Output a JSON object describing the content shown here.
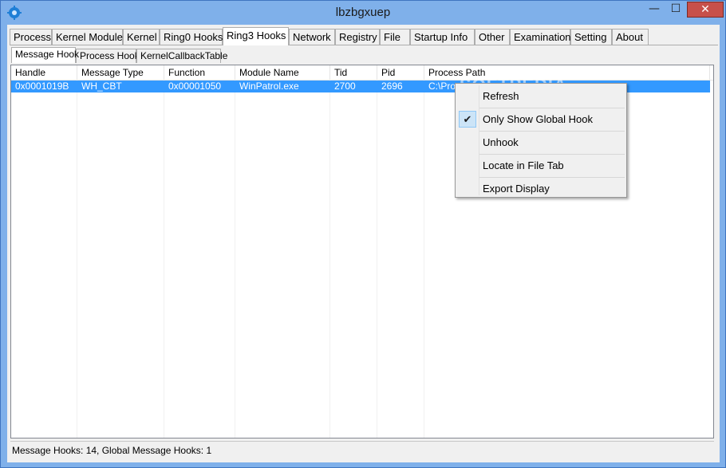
{
  "window": {
    "title": "lbzbgxuep"
  },
  "titlebar_buttons": {
    "minimize": "—",
    "maximize": "☐",
    "close": "✕"
  },
  "main_tabs": [
    {
      "label": "Process"
    },
    {
      "label": "Kernel Module"
    },
    {
      "label": "Kernel"
    },
    {
      "label": "Ring0 Hooks"
    },
    {
      "label": "Ring3 Hooks",
      "active": true
    },
    {
      "label": "Network"
    },
    {
      "label": "Registry"
    },
    {
      "label": "File"
    },
    {
      "label": "Startup Info"
    },
    {
      "label": "Other"
    },
    {
      "label": "Examination"
    },
    {
      "label": "Setting"
    },
    {
      "label": "About"
    }
  ],
  "sub_tabs": [
    {
      "label": "Message Hook",
      "active": true
    },
    {
      "label": "Process Hook"
    },
    {
      "label": "KernelCallbackTable"
    }
  ],
  "table": {
    "columns": [
      "Handle",
      "Message Type",
      "Function",
      "Module Name",
      "Tid",
      "Pid",
      "Process Path"
    ],
    "rows": [
      [
        "0x0001019B",
        "WH_CBT",
        "0x00001050",
        "WinPatrol.exe",
        "2700",
        "2696",
        "C:\\Proc"
      ]
    ]
  },
  "context_menu": {
    "items": [
      {
        "label": "Refresh"
      },
      {
        "label": "Only Show Global Hook",
        "checked": true
      },
      {
        "label": "Unhook"
      },
      {
        "label": "Locate in File Tab"
      },
      {
        "label": "Export Display"
      }
    ]
  },
  "status": {
    "text": "Message Hooks: 14, Global Message Hooks: 1"
  },
  "watermark": "SOFTPEDIA",
  "colors": {
    "selection": "#3399ff",
    "frame": "#7fb0ea",
    "close": "#c7504a"
  }
}
